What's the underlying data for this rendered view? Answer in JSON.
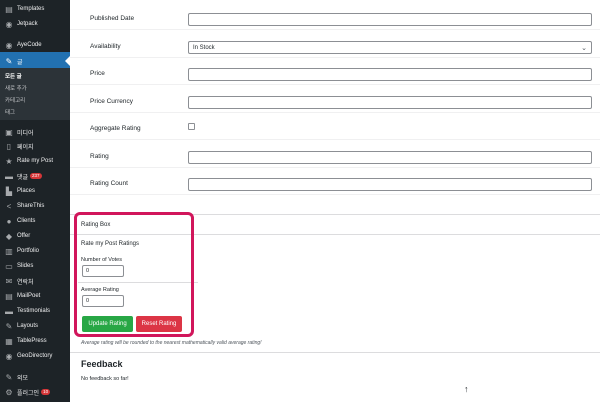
{
  "sidebar": {
    "items": [
      {
        "icon": "templates-icon",
        "glyph": "▤",
        "label": "Templates"
      },
      {
        "icon": "jetpack-icon",
        "glyph": "◉",
        "label": "Jetpack"
      },
      {
        "icon": "ayecode-icon",
        "glyph": "◉",
        "label": "AyeCode"
      },
      {
        "icon": "pin-icon",
        "glyph": "✎",
        "label": "글"
      },
      {
        "icon": "media-icon",
        "glyph": "▣",
        "label": "미디어"
      },
      {
        "icon": "page-icon",
        "glyph": "▯",
        "label": "페이지"
      },
      {
        "icon": "star-icon",
        "glyph": "★",
        "label": "Rate my Post"
      },
      {
        "icon": "comment-icon",
        "glyph": "▬",
        "label": "댓글",
        "badge": "237"
      },
      {
        "icon": "places-icon",
        "glyph": "▙",
        "label": "Places"
      },
      {
        "icon": "share-icon",
        "glyph": "<",
        "label": "ShareThis"
      },
      {
        "icon": "clients-icon",
        "glyph": "●",
        "label": "Clients"
      },
      {
        "icon": "offer-icon",
        "glyph": "◆",
        "label": "Offer"
      },
      {
        "icon": "portfolio-icon",
        "glyph": "▥",
        "label": "Portfolio"
      },
      {
        "icon": "slides-icon",
        "glyph": "▭",
        "label": "Slides"
      },
      {
        "icon": "contact-icon",
        "glyph": "✉",
        "label": "연락처"
      },
      {
        "icon": "mailpoet-icon",
        "glyph": "▤",
        "label": "MailPoet"
      },
      {
        "icon": "testimonials-icon",
        "glyph": "▬",
        "label": "Testimonials"
      },
      {
        "icon": "layouts-icon",
        "glyph": "✎",
        "label": "Layouts"
      },
      {
        "icon": "tablepress-icon",
        "glyph": "▦",
        "label": "TablePress"
      },
      {
        "icon": "geodirectory-icon",
        "glyph": "◉",
        "label": "GeoDirectory"
      },
      {
        "icon": "appearance-icon",
        "glyph": "✎",
        "label": "외모"
      },
      {
        "icon": "plugins-icon",
        "glyph": "⚙",
        "label": "플러그인",
        "badge": "10"
      }
    ],
    "submenu": [
      "모든 글",
      "새로 추가",
      "카테고리",
      "태그"
    ]
  },
  "fields": {
    "published_date": {
      "label": "Published Date",
      "value": ""
    },
    "availability": {
      "label": "Availability",
      "value": "In Stock"
    },
    "price": {
      "label": "Price",
      "value": ""
    },
    "price_currency": {
      "label": "Price Currency",
      "value": ""
    },
    "aggregate_rating": {
      "label": "Aggregate Rating",
      "checked": false
    },
    "rating": {
      "label": "Rating",
      "value": ""
    },
    "rating_count": {
      "label": "Rating Count",
      "value": ""
    }
  },
  "rating_box": {
    "title": "Rating Box",
    "subtitle": "Rate my Post Ratings",
    "votes_label": "Number of Votes",
    "votes_value": "0",
    "avg_label": "Average Rating",
    "avg_value": "0",
    "update_label": "Update Rating",
    "reset_label": "Reset Rating",
    "note": "Average rating will be rounded to the nearest mathematically valid average rating!"
  },
  "feedback": {
    "title": "Feedback",
    "text": "No feedback so far!"
  },
  "colors": {
    "sidebar_bg": "#1d2327",
    "active_bg": "#2271b1",
    "update_btn": "#28a745",
    "reset_btn": "#dc3545",
    "highlight": "#d1165b",
    "badge": "#d63638"
  }
}
